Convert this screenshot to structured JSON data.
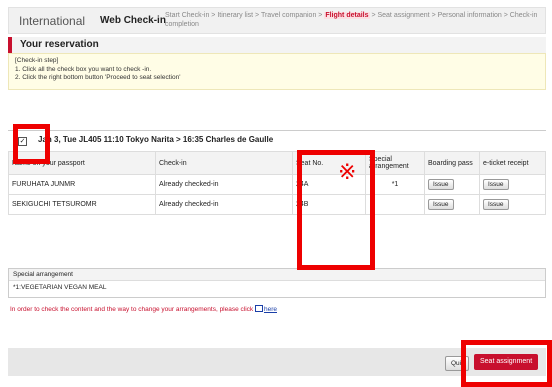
{
  "header": {
    "international": "International",
    "title": "Web Check-in",
    "steps_before": "Start Check-in > Itinerary list > Travel companion > ",
    "current_step": "Flight details",
    "steps_after": " > Seat assignment > Personal information > Check-in completion"
  },
  "reservation": {
    "title": "Your reservation",
    "steps_heading": "[Check-in step]",
    "step1": "1. Click all the check box you want to check -in.",
    "step2": "2. Click the right bottom button 'Proceed to seat selection'"
  },
  "flight": {
    "checkbox": "✓",
    "summary": "Jan 3, Tue JL405 11:10 Tokyo Narita > 16:35 Charles de Gaulle"
  },
  "table": {
    "headers": {
      "name": "Name on your passport",
      "checkin": "Check-in",
      "seat": "Seat No.",
      "special": "Special arrangement",
      "boarding": "Boarding pass",
      "eticket": "e-ticket receipt"
    },
    "rows": [
      {
        "name": "FURUHATA JUNMR",
        "checkin": "Already checked-in",
        "seat": "24A",
        "special": "*1",
        "boarding": "Issue",
        "eticket": "Issue"
      },
      {
        "name": "SEKIGUCHI TETSUROMR",
        "checkin": "Already checked-in",
        "seat": "24B",
        "special": "",
        "boarding": "Issue",
        "eticket": "Issue"
      }
    ]
  },
  "special_arrangement": {
    "title": "Special arrangement",
    "value": "*1:VEGETARIAN VEGAN MEAL"
  },
  "note": {
    "text": "In order to check the content and the way to change your arrangements, please click ",
    "link": "here"
  },
  "footer": {
    "quit": "Quit",
    "seat_assignment": "Seat assignment"
  },
  "annotation": {
    "mark": "※",
    "highlight_color": "#ee0000"
  },
  "colors": {
    "accent": "#c8102e",
    "link": "#1a3fa8"
  }
}
